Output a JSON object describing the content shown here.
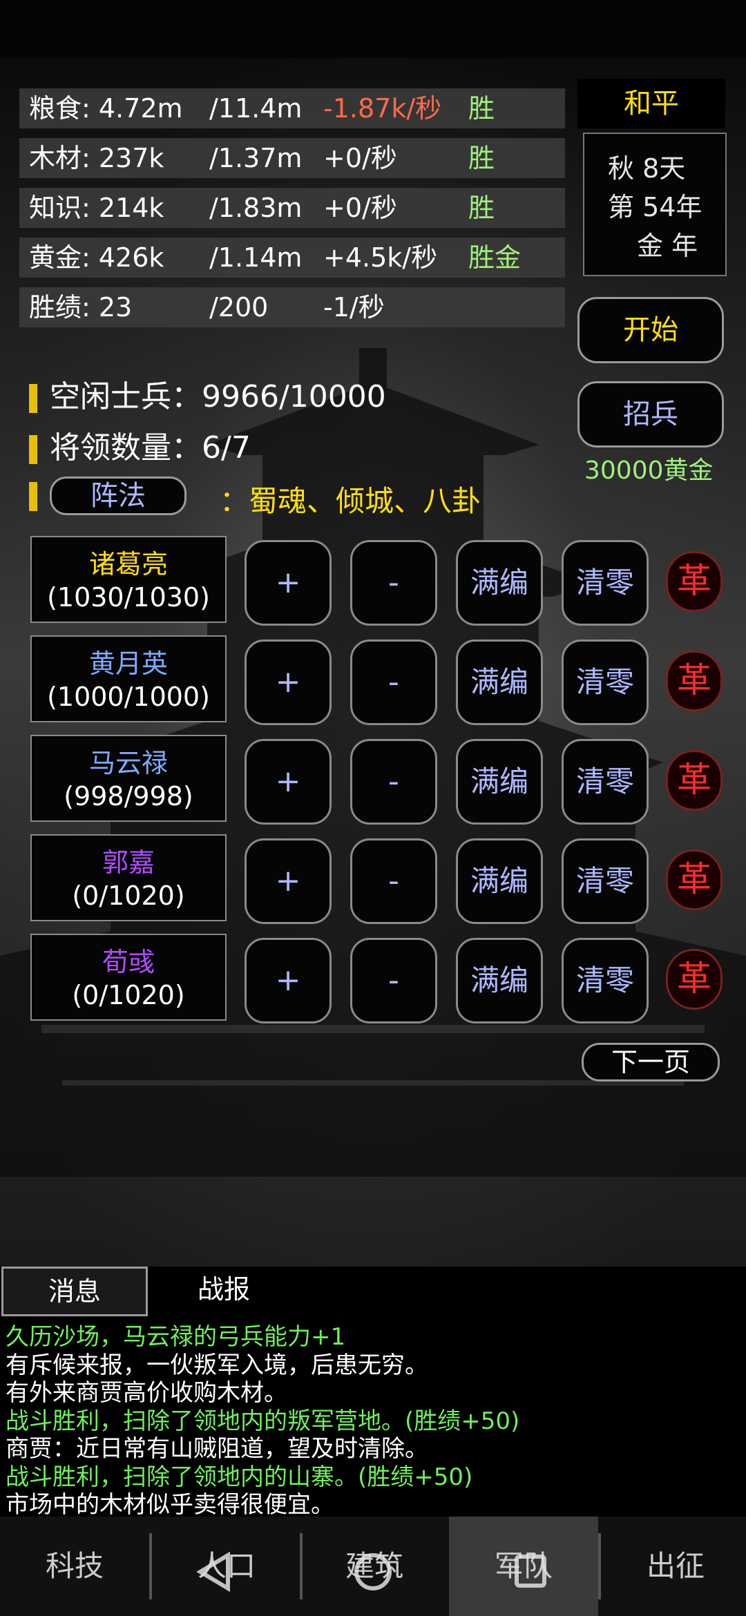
{
  "resources": [
    {
      "name": "粮食: 4.72m",
      "cap": "/11.4m",
      "rate": "-1.87k/秒",
      "status": "胜",
      "negative": true
    },
    {
      "name": "木材: 237k",
      "cap": "/1.37m",
      "rate": "+0/秒",
      "status": "胜",
      "negative": false
    },
    {
      "name": "知识: 214k",
      "cap": "/1.83m",
      "rate": "+0/秒",
      "status": "胜",
      "negative": false
    },
    {
      "name": "黄金: 426k",
      "cap": "/1.14m",
      "rate": "+4.5k/秒",
      "status": "胜金",
      "negative": false
    },
    {
      "name": "胜绩: 23",
      "cap": "/200",
      "rate": "-1/秒",
      "status": "",
      "negative": false
    }
  ],
  "side": {
    "peace": "和平",
    "date_line1": "秋 8天",
    "date_line2": "第 54年",
    "date_line3": "金 年",
    "start_label": "开始",
    "recruit_label": "招兵",
    "recruit_cost": "30000黄金"
  },
  "army": {
    "idle_soldiers": "空闲士兵：9966/10000",
    "general_count": "将领数量：6/7",
    "formation_label": "阵法",
    "formation_value": "：蜀魂、倾城、八卦"
  },
  "generals": [
    {
      "name": "诸葛亮",
      "count": "(1030/1030)",
      "color": "#ffe000"
    },
    {
      "name": "黄月英",
      "count": "(1000/1000)",
      "color": "#7fa8ff"
    },
    {
      "name": "马云禄",
      "count": "(998/998)",
      "color": "#7fa8ff"
    },
    {
      "name": "郭嘉",
      "count": "(0/1020)",
      "color": "#b04cff"
    },
    {
      "name": "荀彧",
      "count": "(0/1020)",
      "color": "#b04cff"
    }
  ],
  "general_actions": {
    "plus": "+",
    "minus": "-",
    "fill": "满编",
    "clear": "清零",
    "dismiss": "革"
  },
  "next_page": "下一页",
  "tabs": {
    "messages": "消息",
    "reports": "战报"
  },
  "log": [
    {
      "text": "久历沙场，马云禄的弓兵能力+1",
      "kind": "g"
    },
    {
      "text": "有斥候来报，一伙叛军入境，后患无穷。",
      "kind": "w"
    },
    {
      "text": "有外来商贾高价收购木材。",
      "kind": "w"
    },
    {
      "text": "战斗胜利，扫除了领地内的叛军营地。(胜绩+50)",
      "kind": "g"
    },
    {
      "text": "商贾：近日常有山贼阻道，望及时清除。",
      "kind": "w"
    },
    {
      "text": "战斗胜利，扫除了领地内的山寨。(胜绩+50)",
      "kind": "g"
    },
    {
      "text": "市场中的木材似乎卖得很便宜。",
      "kind": "w"
    }
  ],
  "nav": [
    {
      "label": "科技",
      "active": false
    },
    {
      "label": "人口",
      "active": false
    },
    {
      "label": "建筑",
      "active": false
    },
    {
      "label": "军队",
      "active": true
    },
    {
      "label": "出征",
      "active": false
    }
  ],
  "system_nav_icons": [
    "back-icon",
    "home-icon",
    "recents-icon"
  ]
}
